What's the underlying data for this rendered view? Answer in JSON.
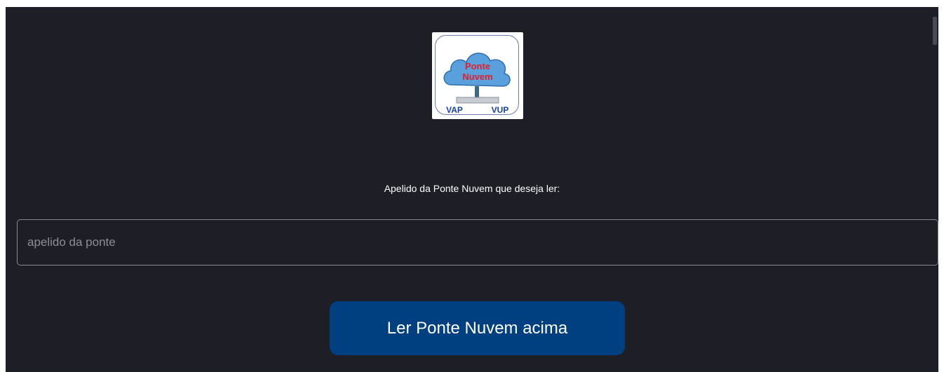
{
  "logo": {
    "line1": "Ponte",
    "line2": "Nuvem",
    "left_label": "VAP",
    "right_label": "VUP"
  },
  "form": {
    "prompt": "Apelido da Ponte Nuvem que deseja ler:",
    "input_placeholder": "apelido da ponte",
    "input_value": "",
    "submit_label": "Ler Ponte Nuvem acima"
  },
  "colors": {
    "background": "#1e1e26",
    "button": "#004080",
    "cloud": "#5aa0dc",
    "logo_text_red": "#e0202a",
    "logo_text_blue": "#1a3fa8"
  }
}
